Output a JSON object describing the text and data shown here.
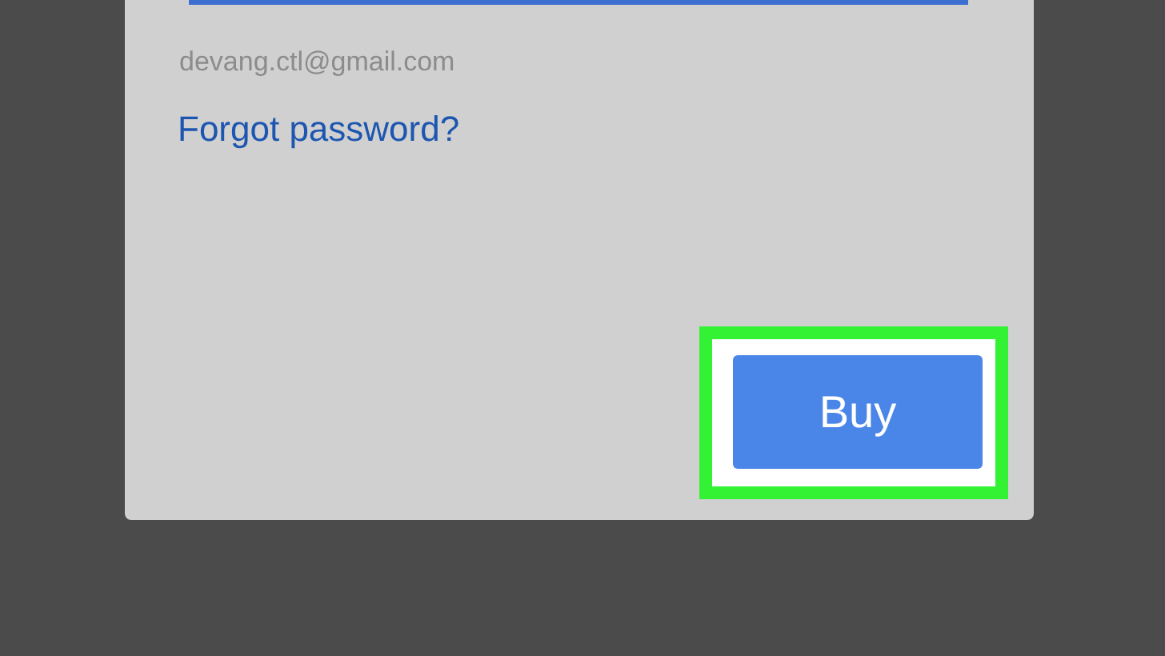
{
  "form": {
    "account_email": "devang.ctl@gmail.com",
    "forgot_link": "Forgot password?"
  },
  "buy_button": {
    "label": "Buy",
    "highlighted": true
  }
}
